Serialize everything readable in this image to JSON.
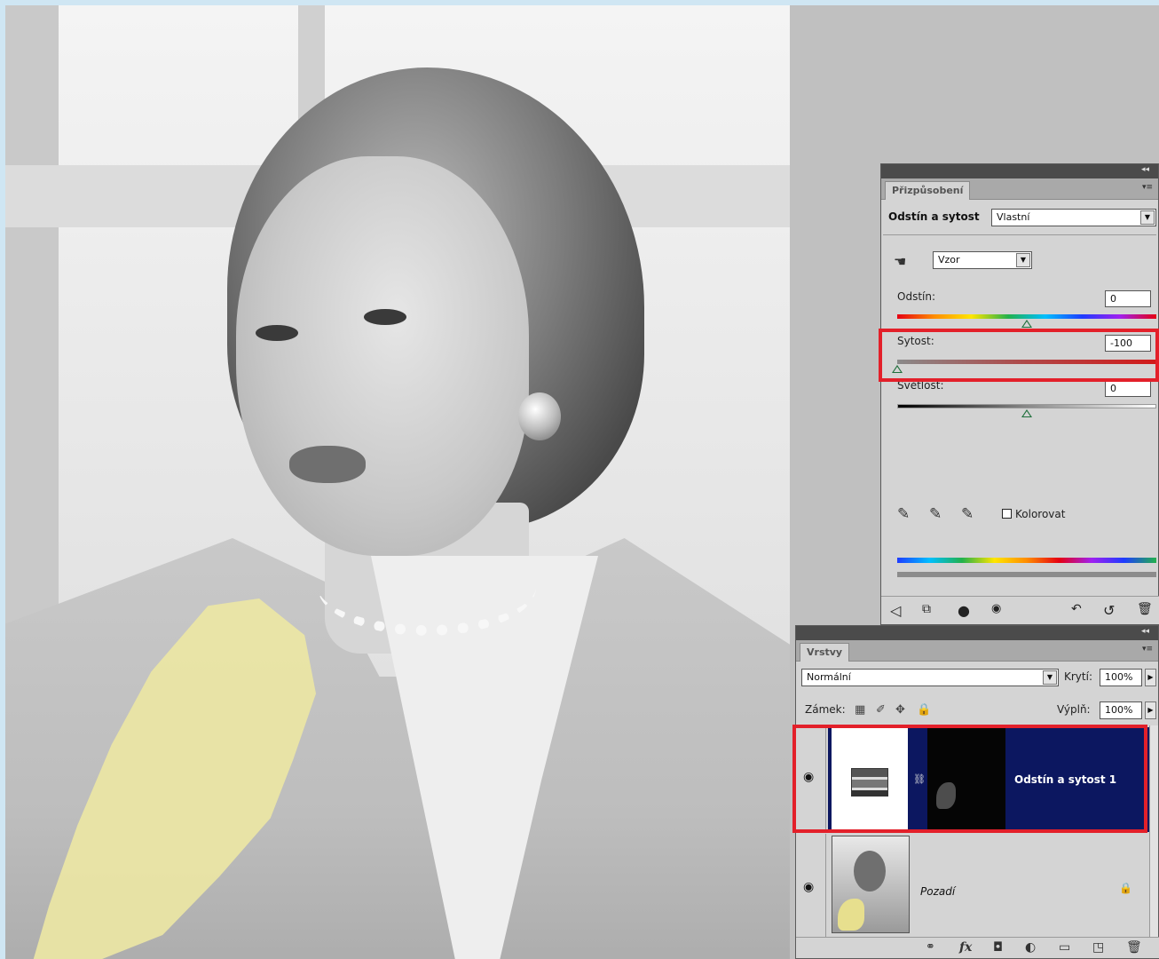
{
  "adjustments": {
    "tab_label": "Přizpůsobení",
    "title": "Odstín a sytost",
    "preset_value": "Vlastní",
    "channel_value": "Vzor",
    "hue": {
      "label": "Odstín:",
      "value": "0",
      "level": 0.5
    },
    "saturation": {
      "label": "Sytost:",
      "value": "-100",
      "level": 0.0
    },
    "lightness": {
      "label": "Světlost:",
      "value": "0",
      "level": 0.5
    },
    "colorize_label": "Kolorovat",
    "colorize_checked": false
  },
  "layers": {
    "tab_label": "Vrstvy",
    "blend_mode": "Normální",
    "opacity_label": "Krytí:",
    "opacity_value": "100%",
    "lock_label": "Zámek:",
    "fill_label": "Výplň:",
    "fill_value": "100%",
    "items": [
      {
        "name": "Odstín a sytost 1",
        "selected": true,
        "visible": true,
        "type": "adjustment"
      },
      {
        "name": "Pozadí",
        "selected": false,
        "visible": true,
        "type": "background",
        "locked": true
      }
    ]
  },
  "colors": {
    "highlight": "#e3202a",
    "selection": "#0c1760",
    "panel": "#d4d4d4",
    "workspace": "#c0c0c0"
  },
  "icons": [
    "hand-icon",
    "eyedropper-icon",
    "eyedropper-plus-icon",
    "eyedropper-minus-icon",
    "eye-icon",
    "lock-icon",
    "link-icon",
    "fx-icon",
    "mask-icon",
    "adjustment-layer-icon",
    "folder-icon",
    "new-layer-icon",
    "trash-icon"
  ]
}
